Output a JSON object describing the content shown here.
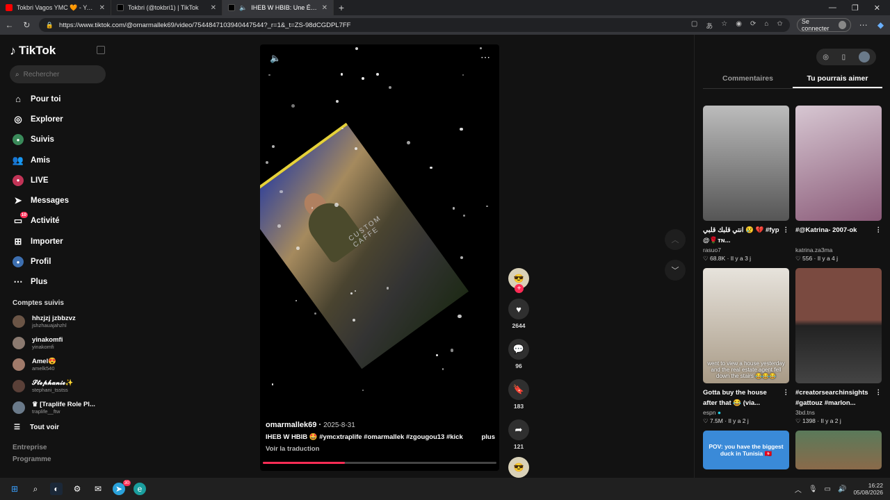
{
  "browser": {
    "tabs": [
      {
        "title": "Tokbri Vagos YMC 🧡 - YouTube",
        "color": "#ff0000",
        "active": false
      },
      {
        "title": "Tokbri (@tokbri1) | TikTok",
        "color": "#000000",
        "active": false
      },
      {
        "title": "IHEB W HBIB: Une Énergie In",
        "color": "#000000",
        "active": true
      }
    ],
    "url": "https://www.tiktok.com/@omarmallek69/video/7544847103940447544?_r=1&_t=ZS-98dCGDPL7FF",
    "signin_label": "Se connecter"
  },
  "sidebar": {
    "brand": "TikTok",
    "search_placeholder": "Rechercher",
    "nav": [
      {
        "label": "Pour toi",
        "icon": "home-icon"
      },
      {
        "label": "Explorer",
        "icon": "compass-icon"
      },
      {
        "label": "Suivis",
        "icon": "following-icon"
      },
      {
        "label": "Amis",
        "icon": "friends-icon"
      },
      {
        "label": "LIVE",
        "icon": "live-icon"
      },
      {
        "label": "Messages",
        "icon": "messages-icon"
      },
      {
        "label": "Activité",
        "icon": "activity-icon",
        "badge": "10"
      },
      {
        "label": "Importer",
        "icon": "upload-icon"
      },
      {
        "label": "Profil",
        "icon": "profile-icon"
      },
      {
        "label": "Plus",
        "icon": "more-icon"
      }
    ],
    "followed_title": "Comptes suivis",
    "followed": [
      {
        "name": "hhzjzj jzbbzvz",
        "handle": "jshzhauajahzhl"
      },
      {
        "name": "yinakomfi",
        "handle": "yinakomfi"
      },
      {
        "name": "Amel😍",
        "handle": "amelk540"
      },
      {
        "name": "𝓢𝓽𝓮𝓹𝓱𝓪𝓷𝓲𝓮✨",
        "handle": "stephani_tsstss"
      },
      {
        "name": "♛ [Traplife Role Pl...",
        "handle": "traplife__ftw"
      }
    ],
    "see_all": "Tout voir",
    "footer_1": "Entreprise",
    "footer_2": "Programme"
  },
  "video": {
    "author": "omarmallek69",
    "date": "2025-8-31",
    "description": "IHEB W HBIB 🤩 #ymcxtraplife #omarmallek #zgougou13 #kick",
    "more": "plus",
    "translate": "Voir la traduction",
    "sign_text": "CUSTOM CAFFE",
    "progress": 0.35
  },
  "actions": {
    "likes": "2644",
    "comments": "96",
    "saves": "183",
    "shares": "121"
  },
  "right_panel": {
    "tabs": [
      "Commentaires",
      "Tu pourrais aimer"
    ],
    "selected_tab": 1,
    "cards": [
      {
        "title": "انتي قلبك قلبي 😢 💔 #fyp @🌹ᴛɴ...",
        "user": "rasuo7",
        "likes": "68.8K",
        "age": "Il y a 3 j",
        "overlay": "",
        "bg": "#8a8a8a"
      },
      {
        "title": "#@Katrina- 2007-ok",
        "user": "katrina.za3ma",
        "likes": "556",
        "age": "Il y a 4 j",
        "overlay": "",
        "bg": "#b49aa8"
      },
      {
        "title": "Gotta buy the house after that 😂 (via...",
        "user": "espn",
        "likes": "7.5M",
        "age": "Il y a 2 j",
        "overlay": "went to view a house yesterday and the real estate agent fell down the stairs 😂😂😂",
        "bg": "#cfc8bd"
      },
      {
        "title": "#creatorsearchinsights #gattouz #marlon...",
        "user": "3bd.tns",
        "likes": "1398",
        "age": "Il y a 2 j",
        "overlay": "",
        "bg": "#7a5a52"
      }
    ],
    "partial_card_text": "POV: you have the biggest duck in Tunisia 🇹🇳"
  },
  "taskbar": {
    "time": "16:22",
    "date": "05/08/2026",
    "badge": "30"
  }
}
